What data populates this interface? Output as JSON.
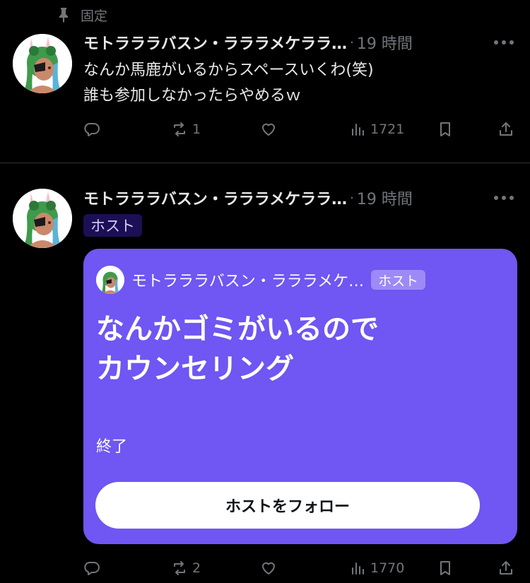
{
  "pinned_label": "固定",
  "tweets": [
    {
      "author": "モトラララバスン・ラララメケララ…",
      "separator": "·",
      "time": "19 時間",
      "lines": [
        "なんか馬鹿がいるからスペースいくわ(笑)",
        "誰も参加しなかったらやめるｗ"
      ],
      "replies": "",
      "retweets": "1",
      "likes": "",
      "views": "1721"
    },
    {
      "author": "モトラララバスン・ラララメケララ…",
      "separator": "·",
      "time": "19 時間",
      "host_badge": "ホスト",
      "replies": "",
      "retweets": "2",
      "likes": "",
      "views": "1770",
      "space": {
        "host_name": "モトラララバスン・ラララメケ…",
        "host_badge": "ホスト",
        "title_lines": [
          "なんかゴミがいるので",
          "カウンセリング"
        ],
        "status": "終了",
        "follow_label": "ホストをフォロー"
      }
    }
  ],
  "colors": {
    "background": "#000000",
    "text": "#e7e9ea",
    "muted": "#71767b",
    "space_card": "#7056f2",
    "host_badge": "#1d0f55"
  },
  "icons": [
    "pin-icon",
    "more-icon",
    "reply-icon",
    "retweet-icon",
    "like-icon",
    "views-icon",
    "bookmark-icon",
    "share-icon"
  ]
}
